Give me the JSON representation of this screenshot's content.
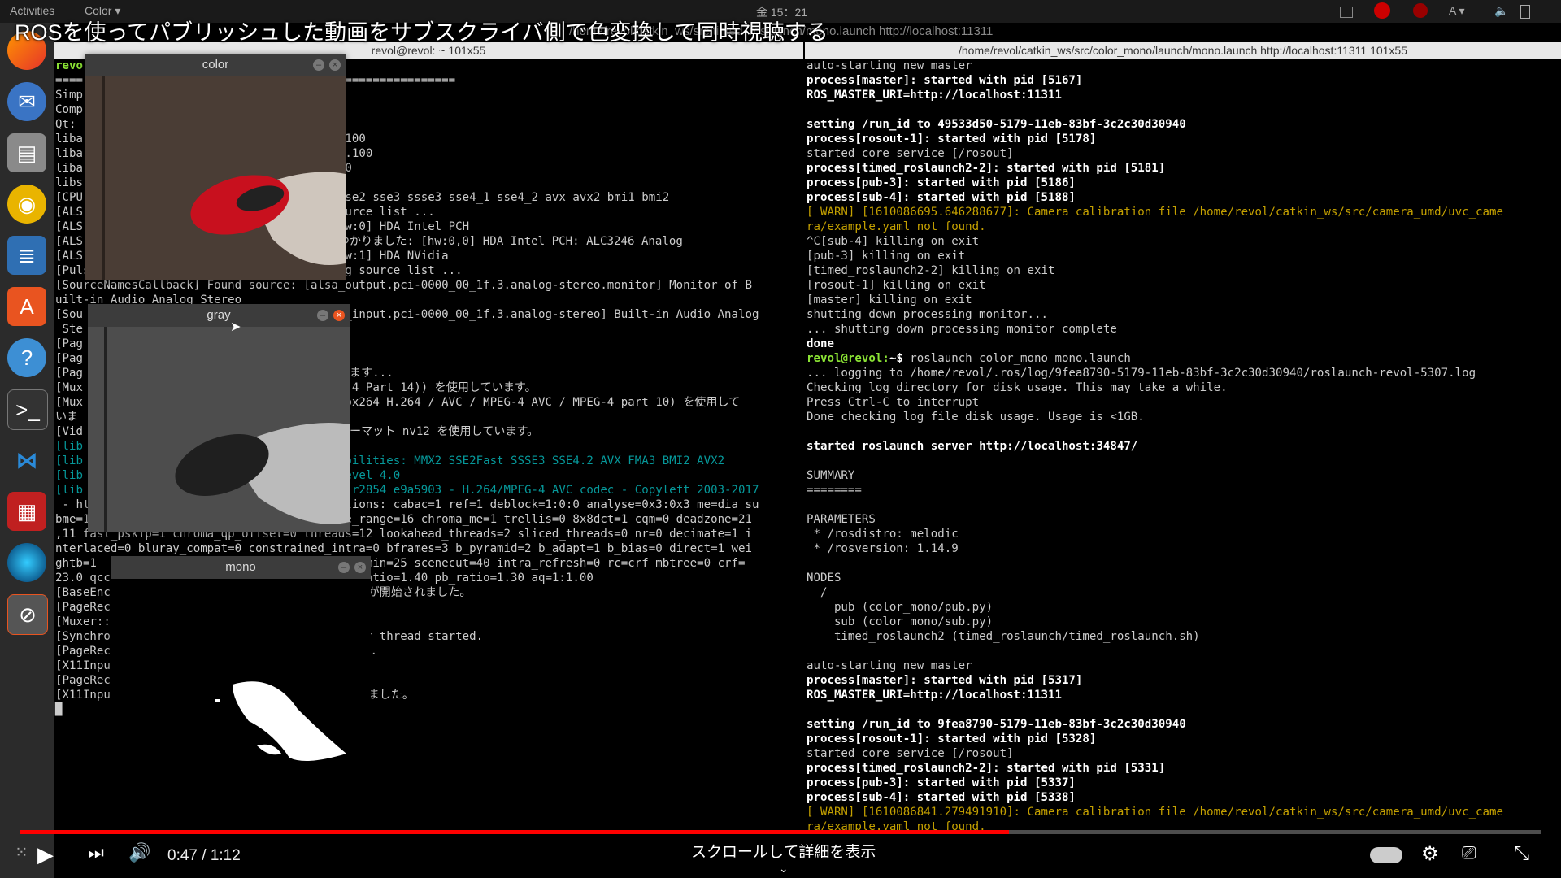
{
  "topbar": {
    "activities": "Activities",
    "app_menu": "Color ▾",
    "clock": "金 15：21",
    "lang": "A ▾"
  },
  "video": {
    "title": "ROSを使ってパブリッシュした動画をサブスクライバ側で色変換して同時視聴する",
    "overlay_window_title": "/home/revol/catkin_ws/src/timed_roslaunch/mono.launch http://localhost:11311",
    "time": "0:47 / 1:12",
    "scroll_hint": "スクロールして詳細を表示",
    "progress": 0.65
  },
  "dock": {
    "items": [
      "firefox-icon",
      "thunderbird-icon",
      "files-icon",
      "rhythmbox-icon",
      "writer-icon",
      "software-icon",
      "help-icon",
      "terminal-icon",
      "vscode-icon",
      "recorder-icon",
      "camera-icon",
      "screen-recorder-icon"
    ]
  },
  "left_terminal": {
    "title": "revol@revol: ~ 101x55",
    "lines": [
      "revo",
      "====                                      ================",
      "Simp",
      "Comp",
      "Qt: ",
      "liba                                     .100",
      "liba                                     7.100",
      "liba                                     00",
      "libs",
      "[CPU                                     sse2 sse3 ssse3 sse4_1 sse4_2 avx avx2 bmi1 bmi2",
      "[ALS                                     ource list ...",
      "[ALS                                     hw:0] HDA Intel PCH",
      "[ALS                                     つかりました: [hw:0,0] HDA Intel PCH: ALC3246 Analog",
      "[ALS                                     hw:1] HDA NVidia",
      "[PulseAudioInput::GetSourceList] Generating source list ...",
      "[SourceNamesCallback] Found source: [alsa_output.pci-0000_00_1f.3.analog-stereo.monitor] Monitor of B",
      "uilt-in Audio Analog Stereo",
      "[Sou                                     a_input.pci-0000_00_1f.3.analog-stereo] Built-in Audio Analog",
      " Ste",
      "[Pag",
      "[Pag                                     ",
      "[Pag                                     います...",
      "[Mux                                     G-4 Part 14)) を使用しています。",
      "[Mux                                     ibx264 H.264 / AVC / MPEG-4 AVC / MPEG-4 part 10) を使用して",
      "いま",
      "[Vid                                     ォーマット nv12 を使用しています。",
      "[lib",
      "[lib                                     abilities: MMX2 SSE2Fast SSSE3 SSE4.2 AVX FMA3 BMI2 AVX2",
      "[lib                                     level 4.0",
      "[lib                                     2 r2854 e9a5903 - H.264/MPEG-4 AVC codec - Copyleft 2003-2017",
      " - ht                                    ptions: cabac=1 ref=1 deblock=1:0:0 analyse=0x3:0x3 me=dia su",
      "bme=1 psy=1 psy_rd=1.00:0.00 mixed_ref=0 me_range=16 chroma_me=1 trellis=0 8x8dct=1 cqm=0 deadzone=21",
      ",11 fast_pskip=1 chroma_qp_offset=0 threads=12 lookahead_threads=2 sliced_threads=0 nr=0 decimate=1 i",
      "nterlaced=0 bluray_compat=0 constrained_intra=0 bframes=3 b_pyramid=2 b_adapt=1 b_bias=0 direct=1 wei",
      "ghtb=1                                    nt_min=25 scenecut=40 intra_refresh=0 rc=crf mbtree=0 crf=",
      "23.0 qcc                                  p_ratio=1.40 pb_ratio=1.30 aq=1:1.00",
      "[BaseEnc                                  ッドが開始されました。",
      "[PageRec                                  こ。",
      "[Muxer::",
      "[Synchro                                  izer thread started.",
      "[PageRec                                  す...",
      "[X11Inpu",
      "[PageRec                                  。",
      "[X11Inpu                                  されました。",
      "█"
    ]
  },
  "right_terminal": {
    "title": "/home/revol/catkin_ws/src/color_mono/launch/mono.launch http://localhost:11311 101x55",
    "lines": [
      {
        "t": "auto-starting new master",
        "s": ""
      },
      {
        "t": "process[master]: started with pid [5167]",
        "s": "b"
      },
      {
        "t": "ROS_MASTER_URI=http://localhost:11311",
        "s": "b"
      },
      {
        "t": "",
        "s": ""
      },
      {
        "t": "setting /run_id to 49533d50-5179-11eb-83bf-3c2c30d30940",
        "s": "b"
      },
      {
        "t": "process[rosout-1]: started with pid [5178]",
        "s": "b"
      },
      {
        "t": "started core service [/rosout]",
        "s": ""
      },
      {
        "t": "process[timed_roslaunch2-2]: started with pid [5181]",
        "s": "b"
      },
      {
        "t": "process[pub-3]: started with pid [5186]",
        "s": "b"
      },
      {
        "t": "process[sub-4]: started with pid [5188]",
        "s": "b"
      },
      {
        "t": "[ WARN] [1610086695.646288677]: Camera calibration file /home/revol/catkin_ws/src/camera_umd/uvc_came",
        "s": "y"
      },
      {
        "t": "ra/example.yaml not found.",
        "s": "y"
      },
      {
        "t": "^C[sub-4] killing on exit",
        "s": ""
      },
      {
        "t": "[pub-3] killing on exit",
        "s": ""
      },
      {
        "t": "[timed_roslaunch2-2] killing on exit",
        "s": ""
      },
      {
        "t": "[rosout-1] killing on exit",
        "s": ""
      },
      {
        "t": "[master] killing on exit",
        "s": ""
      },
      {
        "t": "shutting down processing monitor...",
        "s": ""
      },
      {
        "t": "... shutting down processing monitor complete",
        "s": ""
      },
      {
        "t": "done",
        "s": "b"
      },
      {
        "t": "revol@revol:~$ roslaunch color_mono mono.launch",
        "s": "prompt"
      },
      {
        "t": "... logging to /home/revol/.ros/log/9fea8790-5179-11eb-83bf-3c2c30d30940/roslaunch-revol-5307.log",
        "s": ""
      },
      {
        "t": "Checking log directory for disk usage. This may take a while.",
        "s": ""
      },
      {
        "t": "Press Ctrl-C to interrupt",
        "s": ""
      },
      {
        "t": "Done checking log file disk usage. Usage is <1GB.",
        "s": ""
      },
      {
        "t": "",
        "s": ""
      },
      {
        "t": "started roslaunch server http://localhost:34847/",
        "s": "b"
      },
      {
        "t": "",
        "s": ""
      },
      {
        "t": "SUMMARY",
        "s": ""
      },
      {
        "t": "========",
        "s": ""
      },
      {
        "t": "",
        "s": ""
      },
      {
        "t": "PARAMETERS",
        "s": ""
      },
      {
        "t": " * /rosdistro: melodic",
        "s": ""
      },
      {
        "t": " * /rosversion: 1.14.9",
        "s": ""
      },
      {
        "t": "",
        "s": ""
      },
      {
        "t": "NODES",
        "s": ""
      },
      {
        "t": "  /",
        "s": ""
      },
      {
        "t": "    pub (color_mono/pub.py)",
        "s": ""
      },
      {
        "t": "    sub (color_mono/sub.py)",
        "s": ""
      },
      {
        "t": "    timed_roslaunch2 (timed_roslaunch/timed_roslaunch.sh)",
        "s": ""
      },
      {
        "t": "",
        "s": ""
      },
      {
        "t": "auto-starting new master",
        "s": ""
      },
      {
        "t": "process[master]: started with pid [5317]",
        "s": "b"
      },
      {
        "t": "ROS_MASTER_URI=http://localhost:11311",
        "s": "b"
      },
      {
        "t": "",
        "s": ""
      },
      {
        "t": "setting /run_id to 9fea8790-5179-11eb-83bf-3c2c30d30940",
        "s": "b"
      },
      {
        "t": "process[rosout-1]: started with pid [5328]",
        "s": "b"
      },
      {
        "t": "started core service [/rosout]",
        "s": ""
      },
      {
        "t": "process[timed_roslaunch2-2]: started with pid [5331]",
        "s": "b"
      },
      {
        "t": "process[pub-3]: started with pid [5337]",
        "s": "b"
      },
      {
        "t": "process[sub-4]: started with pid [5338]",
        "s": "b"
      },
      {
        "t": "[ WARN] [1610086841.279491910]: Camera calibration file /home/revol/catkin_ws/src/camera_umd/uvc_came",
        "s": "y"
      },
      {
        "t": "ra/example.yaml not found.",
        "s": "y"
      }
    ]
  },
  "windows": {
    "color": {
      "title": "color"
    },
    "gray": {
      "title": "gray"
    },
    "mono": {
      "title": "mono"
    }
  },
  "colors": {
    "progress": "#ff0000",
    "prompt_green": "#8ae234",
    "warn": "#c4a000"
  }
}
